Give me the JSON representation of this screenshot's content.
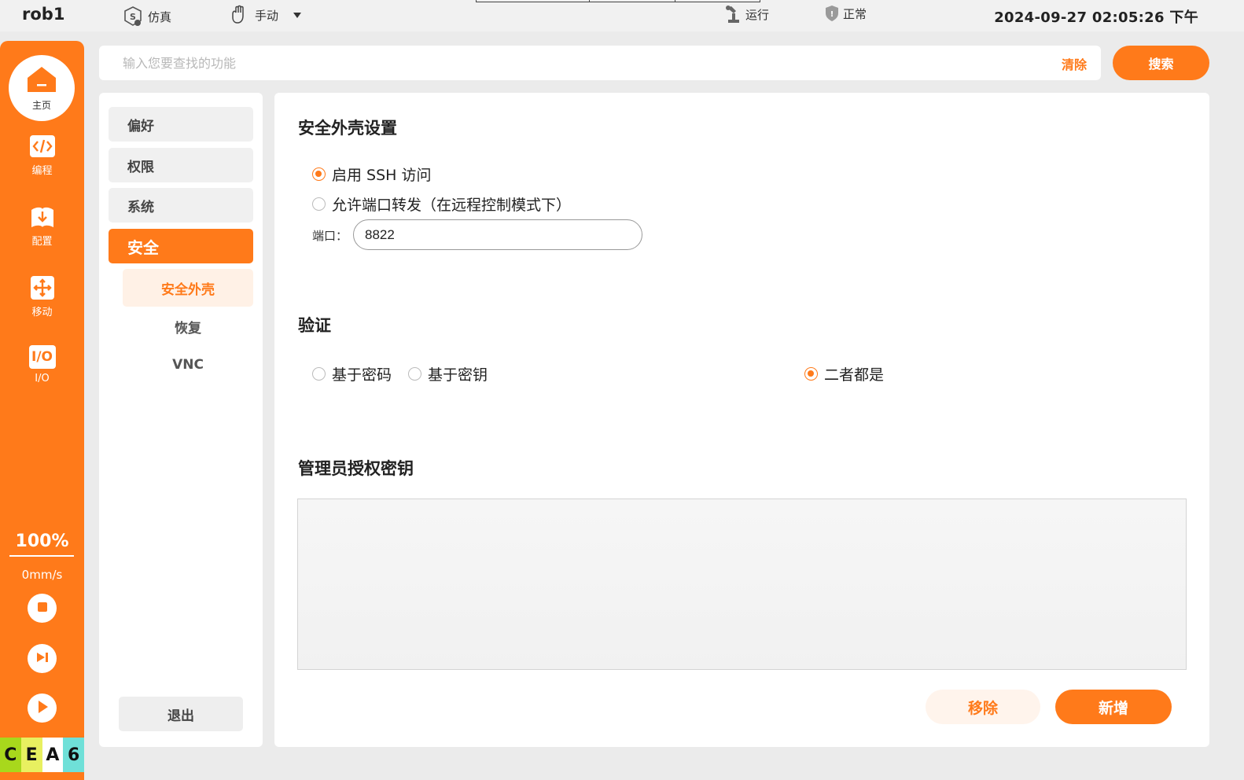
{
  "topbar": {
    "robot_name": "rob1",
    "mode_sim_label": "仿真",
    "mode_manual_label": "手动",
    "run_state_label": "运行",
    "safety_state_label": "正常",
    "datetime": "2024-09-27 02:05:26 下午"
  },
  "rail": {
    "home_label": "主页",
    "items": [
      {
        "label": "编程",
        "icon": "code-icon"
      },
      {
        "label": "配置",
        "icon": "download-icon"
      },
      {
        "label": "移动",
        "icon": "move-icon"
      },
      {
        "label": "I/O",
        "icon": "io-icon"
      }
    ],
    "io_glyph": "I/O",
    "speed_percent": "100%",
    "velocity": "0mm/s",
    "status_chips": [
      {
        "letter": "C",
        "color": "#a8d81c"
      },
      {
        "letter": "E",
        "color": "#e8f060"
      },
      {
        "letter": "A",
        "color": "#ffffff"
      },
      {
        "letter": "6",
        "color": "#6fe0d8"
      }
    ]
  },
  "search": {
    "placeholder": "输入您要查找的功能",
    "value": "",
    "clear_label": "清除",
    "search_label": "搜索"
  },
  "menu": {
    "items": [
      "偏好",
      "权限",
      "系统",
      "安全"
    ],
    "active": "安全",
    "sub_items": [
      "安全外壳",
      "恢复",
      "VNC"
    ],
    "active_sub": "安全外壳",
    "logout_label": "退出"
  },
  "main": {
    "ssh_title": "安全外壳设置",
    "enable_ssh_label": "启用 SSH 访问",
    "enable_ssh_checked": true,
    "port_forward_label": "允许端口转发（在远程控制模式下）",
    "port_forward_checked": false,
    "port_label": "端口：",
    "port_value": "8822",
    "auth_title": "验证",
    "auth_options": [
      "基于密码",
      "基于密钥",
      "二者都是"
    ],
    "auth_selected": "二者都是",
    "keys_title": "管理员授权密钥",
    "remove_label": "移除",
    "add_label": "新增"
  },
  "colors": {
    "accent": "#ff7a1a",
    "accent_light": "#fff1e6",
    "background": "#ebebeb"
  }
}
